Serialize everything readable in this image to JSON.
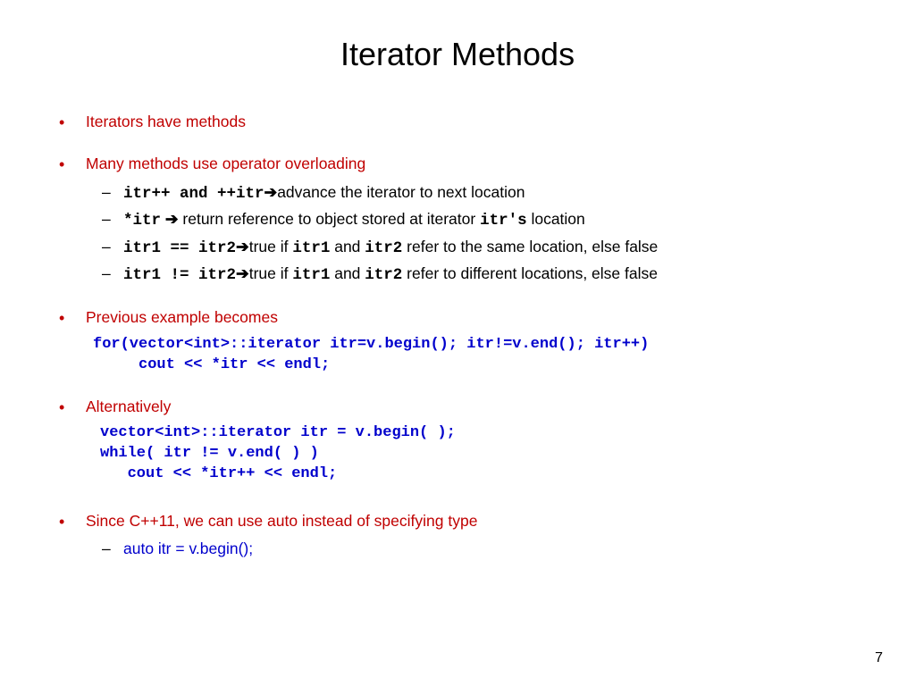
{
  "title": "Iterator Methods",
  "page_number": "7",
  "bullets": {
    "b1": "Iterators have methods",
    "b2": "Many methods use operator overloading",
    "b3": "Previous example becomes",
    "b4": "Alternatively",
    "b5": "Since C++11, we can use auto instead of specifying type"
  },
  "sub": {
    "s1_code": "itr++ and ++itr",
    "s1_arrow": "➔",
    "s1_rest": "advance the iterator to next location",
    "s2_code": "*itr",
    "s2_arrow": " ➔ ",
    "s2_rest1": " return reference to object stored at iterator ",
    "s2_code2": "itr's",
    "s2_rest2": " location",
    "s3_code": " itr1 == itr2",
    "s3_arrow": "➔",
    "s3_rest1": "true if ",
    "s3_code2": "itr1",
    "s3_mid": " and ",
    "s3_code3": "itr2",
    "s3_rest2": " refer to the same location, else false",
    "s4_code": " itr1 != itr2",
    "s4_arrow": "➔",
    "s4_rest1": "true if ",
    "s4_code2": "itr1",
    "s4_mid": " and ",
    "s4_code3": "itr2",
    "s4_rest2": " refer to different locations, else false",
    "auto_line": "auto itr = v.begin();"
  },
  "code1": "for(vector<int>::iterator itr=v.begin(); itr!=v.end(); itr++)\n     cout << *itr << endl;",
  "code2": "vector<int>::iterator itr = v.begin( );\nwhile( itr != v.end( ) )\n   cout << *itr++ << endl;"
}
